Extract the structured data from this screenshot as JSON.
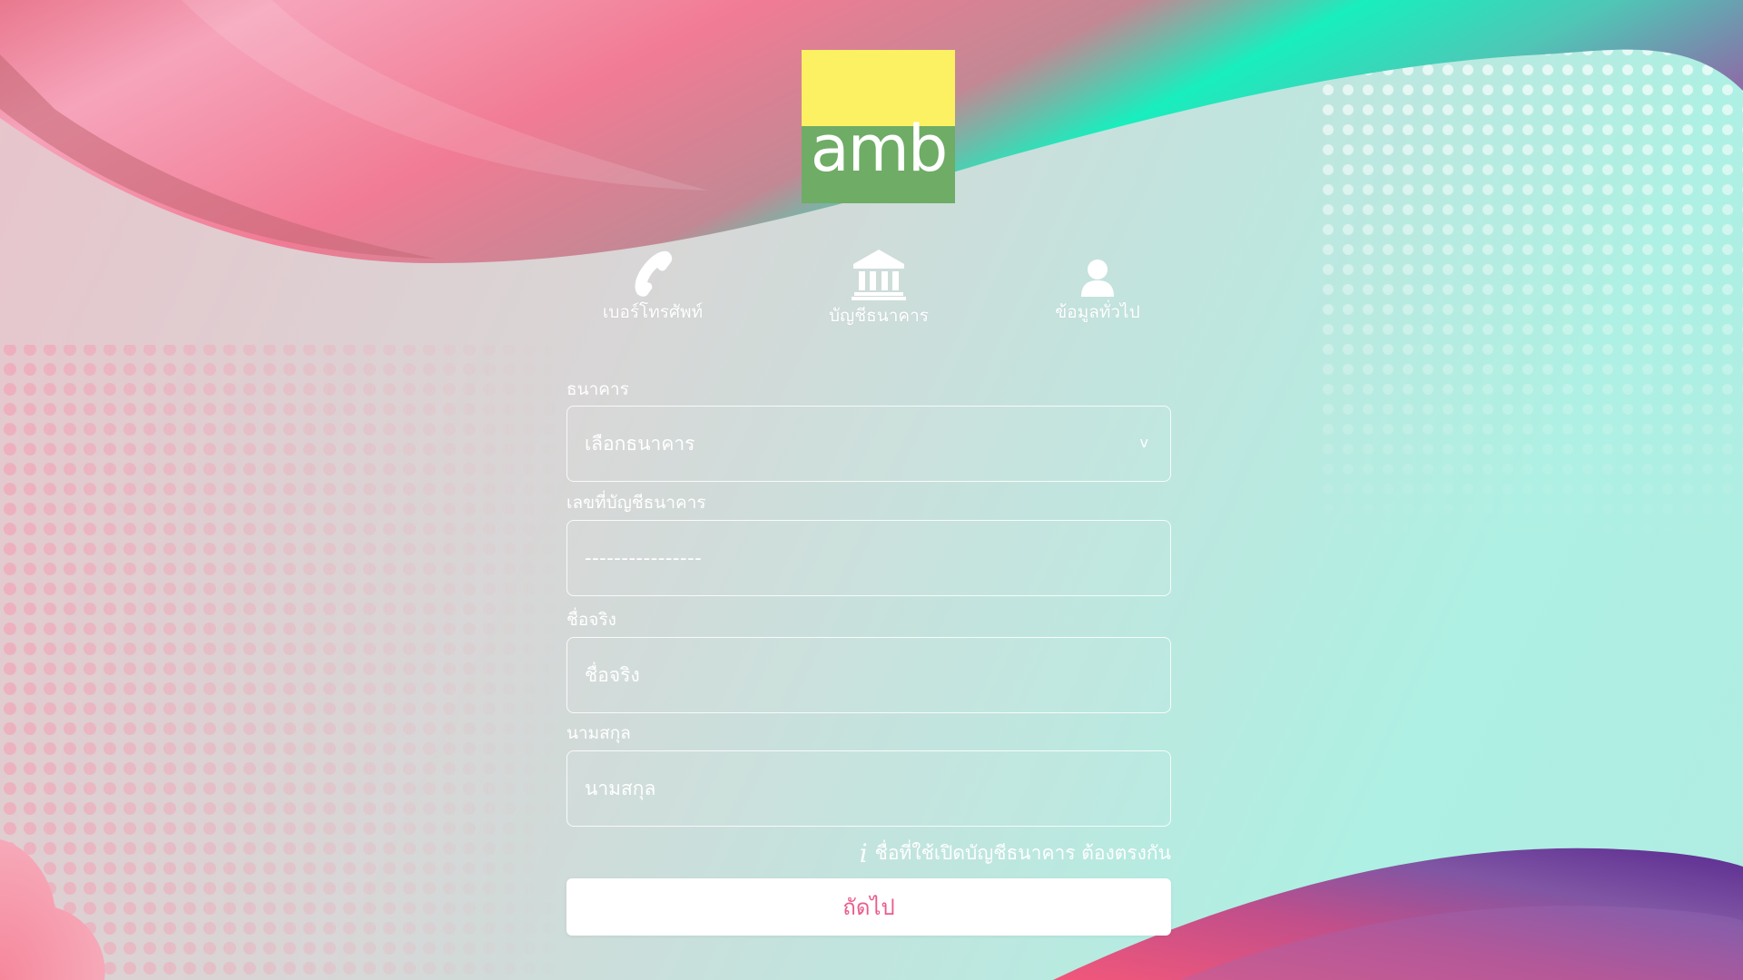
{
  "brand": {
    "logo_text": "amb",
    "logo_top_color": "#fbf163",
    "logo_bottom_color": "#6fac66"
  },
  "steps": [
    {
      "icon": "phone-icon",
      "label": "เบอร์โทรศัพท์"
    },
    {
      "icon": "bank-icon",
      "label": "บัญชีธนาคาร"
    },
    {
      "icon": "user-icon",
      "label": "ข้อมูลทั่วไป"
    }
  ],
  "form": {
    "bank": {
      "label": "ธนาคาร",
      "value": "เลือกธนาคาร",
      "chevron": "v"
    },
    "account_number": {
      "label": "เลขที่บัญชีธนาคาร",
      "placeholder": "----------------"
    },
    "first_name": {
      "label": "ชื่อจริง",
      "placeholder": "ชื่อจริง"
    },
    "last_name": {
      "label": "นามสกุล",
      "placeholder": "นามสกุล"
    },
    "note": {
      "icon": "info-icon",
      "glyph": "i",
      "text": "ชื่อที่ใช้เปิดบัญชีธนาคาร ต้องตรงกัน"
    },
    "next_label": "ถัดไป"
  },
  "colors": {
    "accent": "#ea5d8a",
    "field_border": "#ffffff"
  }
}
